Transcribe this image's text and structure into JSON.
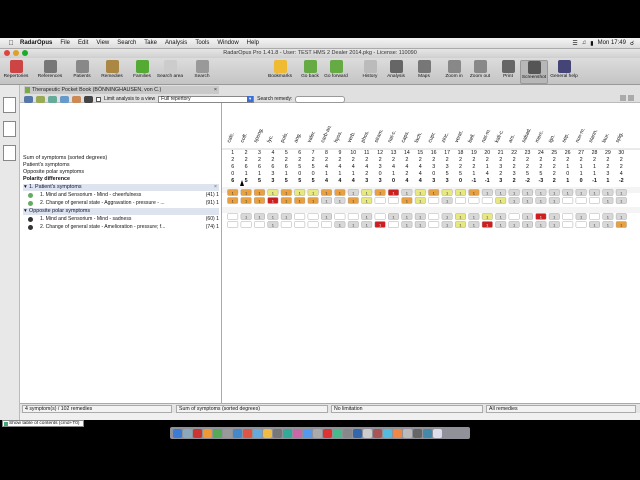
{
  "menubar": {
    "app": "RadarOpus",
    "items": [
      "File",
      "Edit",
      "View",
      "Search",
      "Take",
      "Analysis",
      "Tools",
      "Window",
      "Help"
    ],
    "clock": "Mon 17:49"
  },
  "window": {
    "title": "RadarOpus Pro 1.41.8 - User: TEST HMS 2 Dealer 2014.pkg - License: 110090"
  },
  "toolbar": {
    "items": [
      {
        "name": "repertories",
        "label": "Repertories",
        "color": "#c44"
      },
      {
        "name": "references",
        "label": "References",
        "color": "#777"
      },
      {
        "name": "patients",
        "label": "Patients",
        "color": "#888"
      },
      {
        "name": "remedies",
        "label": "Remedies",
        "color": "#a84"
      },
      {
        "name": "families",
        "label": "Families",
        "color": "#5a3"
      },
      {
        "name": "search-area",
        "label": "Search area",
        "color": "#ccc"
      },
      {
        "name": "search",
        "label": "Search",
        "color": "#999"
      },
      {
        "name": "bookmarks",
        "label": "Bookmarks",
        "color": "#eb3"
      },
      {
        "name": "go-back",
        "label": "Go back",
        "color": "#6a4"
      },
      {
        "name": "go-forward",
        "label": "Go forward",
        "color": "#6a4"
      },
      {
        "name": "history",
        "label": "History",
        "color": "#bbb"
      },
      {
        "name": "analysis",
        "label": "Analysis",
        "color": "#666"
      },
      {
        "name": "maps",
        "label": "Maps",
        "color": "#777"
      },
      {
        "name": "zoom-in",
        "label": "Zoom in",
        "color": "#888"
      },
      {
        "name": "zoom-out",
        "label": "Zoom out",
        "color": "#888"
      },
      {
        "name": "print",
        "label": "Print",
        "color": "#666"
      },
      {
        "name": "screenshot",
        "label": "Screenshot",
        "color": "#555"
      },
      {
        "name": "general-help",
        "label": "General help",
        "color": "#447"
      }
    ]
  },
  "book": {
    "title": "Therapeutic Pocket Book (BÖNNINGHAUSEN, von C.)",
    "limit_label": "Limit analysis to a view",
    "view_value": "Full repertory",
    "search_label": "Search remedy:",
    "search_value": ""
  },
  "summary": {
    "rows": [
      {
        "label": "Sum of symptoms (sorted degrees)",
        "bold": false
      },
      {
        "label": "Patient's symptoms",
        "bold": false
      },
      {
        "label": "Opposite polar symptoms",
        "bold": false
      },
      {
        "label": "Polarity difference",
        "bold": true
      }
    ]
  },
  "sections": [
    {
      "title": "1. Patient's symptoms",
      "rubrics": [
        {
          "text": "1. Mind and Sensorium - Mind - cheerfulness",
          "count": "(41) 1"
        },
        {
          "text": "2. Change of general state - Aggravation - pressure - ...",
          "count": "(91) 1"
        }
      ]
    },
    {
      "title": "Opposite polar symptoms",
      "rubrics": [
        {
          "text": "1. Mind and Sensorium - Mind - sadness",
          "count": "(60) 1"
        },
        {
          "text": "2. Change of general state - Amelioration - pressure; f...",
          "count": "(74) 1"
        }
      ]
    }
  ],
  "grid": {
    "remedies": [
      "calc.",
      "coff.",
      "spong.",
      "lyc.",
      "puls.",
      "ang.",
      "valer.",
      "carb-an.",
      "hyos.",
      "verb.",
      "phos.",
      "stram.",
      "nat-c.",
      "caps.",
      "lach.",
      "cupr.",
      "zinc.",
      "verat.",
      "bell.",
      "nat-m.",
      "kali-c.",
      "ars.",
      "sabad.",
      "merc.",
      "ign.",
      "sep.",
      "nux-m.",
      "stann.",
      "laur.",
      "spig."
    ],
    "numbers": [
      "1",
      "2",
      "3",
      "4",
      "5",
      "6",
      "7",
      "8",
      "9",
      "10",
      "11",
      "12",
      "13",
      "14",
      "15",
      "16",
      "17",
      "18",
      "19",
      "20",
      "21",
      "22",
      "23",
      "24",
      "25",
      "26",
      "27",
      "28",
      "29",
      "30"
    ],
    "sum_row": [
      "2",
      "2",
      "2",
      "2",
      "2",
      "2",
      "2",
      "2",
      "2",
      "2",
      "2",
      "2",
      "2",
      "2",
      "2",
      "2",
      "2",
      "2",
      "2",
      "2",
      "2",
      "2",
      "2",
      "2",
      "2",
      "2",
      "2",
      "2",
      "2",
      "2"
    ],
    "patient_row": [
      "6",
      "6",
      "6",
      "6",
      "6",
      "5",
      "5",
      "4",
      "4",
      "4",
      "4",
      "3",
      "4",
      "4",
      "4",
      "3",
      "3",
      "2",
      "2",
      "1",
      "3",
      "2",
      "2",
      "2",
      "2",
      "1",
      "1",
      "1",
      "2",
      "2"
    ],
    "opposite_row": [
      "0",
      "1",
      "1",
      "3",
      "1",
      "0",
      "0",
      "1",
      "1",
      "1",
      "2",
      "0",
      "1",
      "2",
      "4",
      "0",
      "5",
      "5",
      "1",
      "4",
      "2",
      "3",
      "5",
      "5",
      "2",
      "0",
      "1",
      "1",
      "3",
      "4"
    ],
    "polarity_row": [
      "6",
      "5",
      "5",
      "3",
      "5",
      "5",
      "5",
      "4",
      "4",
      "4",
      "3",
      "3",
      "0",
      "4",
      "4",
      "3",
      "3",
      "0",
      "-1",
      "-1",
      "3",
      "2",
      "-2",
      "-3",
      "2",
      "1",
      "0",
      "-1",
      "1",
      "-2"
    ],
    "cells": [
      [
        3,
        3,
        3,
        2,
        3,
        2,
        2,
        3,
        3,
        1,
        2,
        3,
        4,
        1,
        2,
        3,
        2,
        2,
        3,
        1,
        1,
        1,
        1,
        1,
        1,
        1,
        1,
        1,
        1,
        1
      ],
      [
        3,
        3,
        3,
        4,
        3,
        3,
        3,
        1,
        1,
        3,
        2,
        0,
        0,
        3,
        2,
        0,
        1,
        0,
        0,
        0,
        2,
        1,
        1,
        1,
        1,
        0,
        0,
        0,
        1,
        1
      ],
      [
        0,
        1,
        1,
        1,
        1,
        0,
        0,
        1,
        0,
        0,
        1,
        0,
        1,
        1,
        1,
        0,
        1,
        2,
        1,
        2,
        1,
        0,
        1,
        4,
        1,
        0,
        1,
        0,
        1,
        1
      ],
      [
        0,
        0,
        0,
        1,
        0,
        0,
        0,
        0,
        1,
        1,
        1,
        4,
        0,
        1,
        1,
        0,
        1,
        2,
        1,
        4,
        1,
        1,
        1,
        1,
        1,
        0,
        0,
        1,
        1,
        3
      ]
    ],
    "levels": {
      "0": "#ffffff",
      "1": "#d8d8d8",
      "2": "#e8e880",
      "3": "#e8a040",
      "4": "#cc2020"
    }
  },
  "status": {
    "symptoms": "4 symptom(s) / 102 remedies",
    "sort": "Sum of symptoms (sorted degrees)",
    "limit": "No limitation",
    "remedies": "All remedies"
  },
  "hint": "Show table of contents (cmd+T0)"
}
